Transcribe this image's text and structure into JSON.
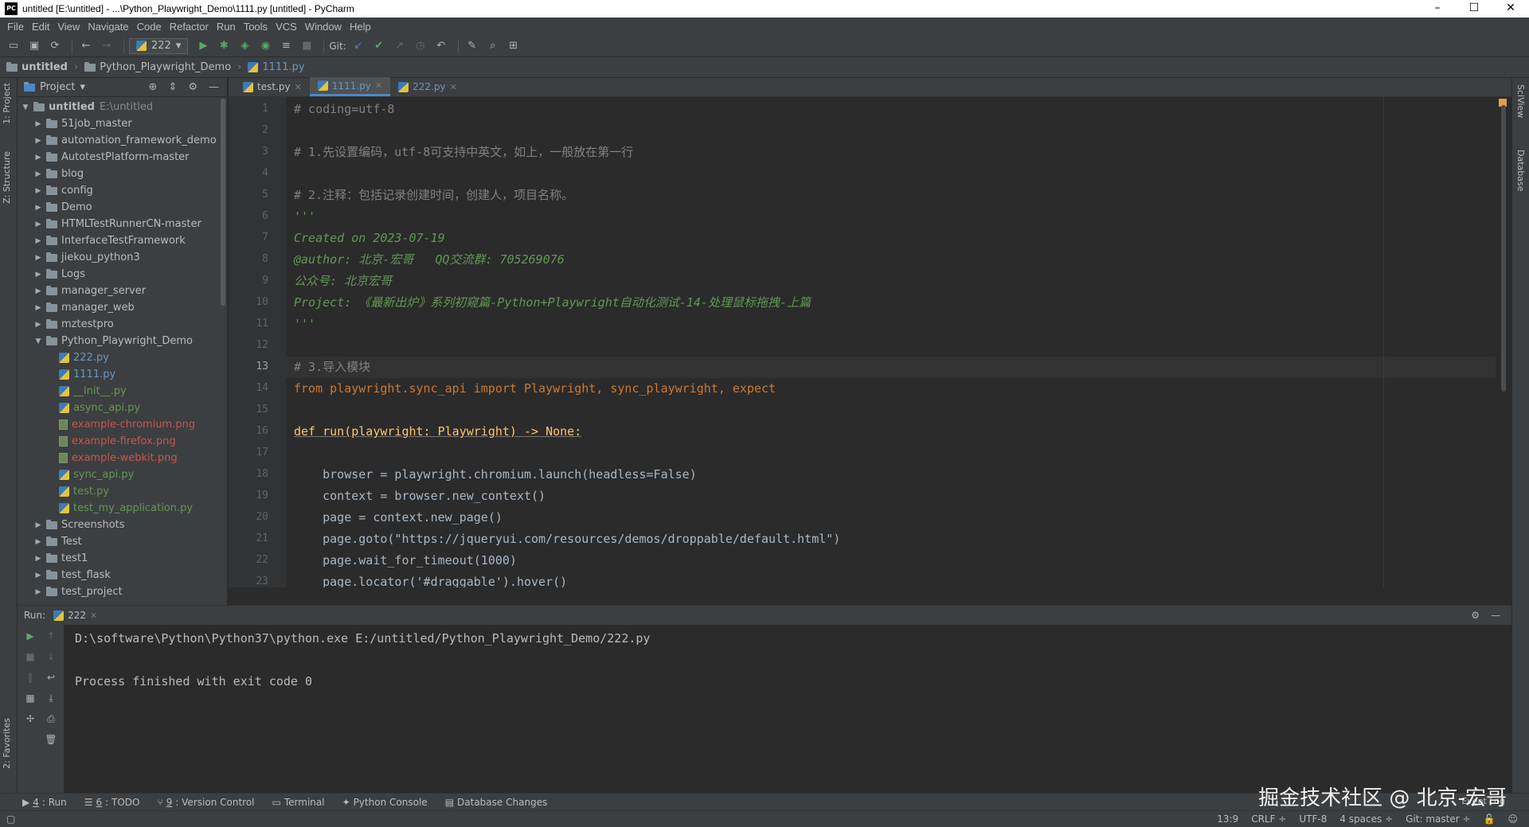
{
  "window": {
    "title": "untitled [E:\\untitled] - ...\\Python_Playwright_Demo\\1111.py [untitled] - PyCharm",
    "app_icon": "PC",
    "minimize": "–",
    "maximize": "☐",
    "close": "✕"
  },
  "menu": [
    "File",
    "Edit",
    "View",
    "Navigate",
    "Code",
    "Refactor",
    "Run",
    "Tools",
    "VCS",
    "Window",
    "Help"
  ],
  "toolbar": {
    "run_config": "222",
    "git_label": "Git:"
  },
  "breadcrumb": [
    "untitled",
    "Python_Playwright_Demo",
    "1111.py"
  ],
  "left_strip": {
    "project_tab": "1: Project",
    "structure_tab": "Z: Structure",
    "favorites_tab": "2: Favorites"
  },
  "right_strip": {
    "sciview_tab": "SciView",
    "database_tab": "Database"
  },
  "project_panel": {
    "title": "Project",
    "root_name": "untitled",
    "root_hint": "E:\\untitled",
    "folders_top": [
      "51job_master",
      "automation_framework_demo",
      "AutotestPlatform-master",
      "blog",
      "config",
      "Demo",
      "HTMLTestRunnerCN-master",
      "InterfaceTestFramework",
      "jiekou_python3",
      "Logs",
      "manager_server",
      "manager_web",
      "mztestpro"
    ],
    "open_folder": "Python_Playwright_Demo",
    "files": [
      {
        "name": "222.py",
        "kind": "py",
        "state": "modified"
      },
      {
        "name": "1111.py",
        "kind": "py",
        "state": "modified"
      },
      {
        "name": "__init__.py",
        "kind": "py",
        "state": "added"
      },
      {
        "name": "async_api.py",
        "kind": "py",
        "state": "added"
      },
      {
        "name": "example-chromium.png",
        "kind": "img",
        "state": "untracked"
      },
      {
        "name": "example-firefox.png",
        "kind": "img",
        "state": "untracked"
      },
      {
        "name": "example-webkit.png",
        "kind": "img",
        "state": "untracked"
      },
      {
        "name": "sync_api.py",
        "kind": "py",
        "state": "added"
      },
      {
        "name": "test.py",
        "kind": "py",
        "state": "added"
      },
      {
        "name": "test_my_application.py",
        "kind": "py",
        "state": "added"
      }
    ],
    "folders_bottom": [
      "Screenshots",
      "Test",
      "test1",
      "test_flask",
      "test_project"
    ]
  },
  "editor": {
    "tabs": [
      {
        "label": "test.py",
        "active": false
      },
      {
        "label": "1111.py",
        "active": true
      },
      {
        "label": "222.py",
        "active": false
      }
    ],
    "current_line": "13",
    "lines": [
      {
        "n": "1",
        "t": "# coding=utf-8"
      },
      {
        "n": "2",
        "t": ""
      },
      {
        "n": "3",
        "t": "# 1.先设置编码，utf-8可支持中英文，如上，一般放在第一行"
      },
      {
        "n": "4",
        "t": ""
      },
      {
        "n": "5",
        "t": "# 2.注释：包括记录创建时间，创建人，项目名称。"
      },
      {
        "n": "6",
        "t": "'''"
      },
      {
        "n": "7",
        "t": "Created on 2023-07-19"
      },
      {
        "n": "8",
        "t": "@author: 北京-宏哥   QQ交流群: 705269076"
      },
      {
        "n": "9",
        "t": "公众号: 北京宏哥"
      },
      {
        "n": "10",
        "t": "Project: 《最新出炉》系列初窥篇-Python+Playwright自动化测试-14-处理鼠标拖拽-上篇"
      },
      {
        "n": "11",
        "t": "'''"
      },
      {
        "n": "12",
        "t": ""
      },
      {
        "n": "13",
        "t": "# 3.导入模块"
      },
      {
        "n": "14",
        "t": "from playwright.sync_api import Playwright, sync_playwright, expect"
      },
      {
        "n": "15",
        "t": ""
      },
      {
        "n": "16",
        "t": "def run(playwright: Playwright) -> None:"
      },
      {
        "n": "17",
        "t": ""
      },
      {
        "n": "18",
        "t": "    browser = playwright.chromium.launch(headless=False)"
      },
      {
        "n": "19",
        "t": "    context = browser.new_context()"
      },
      {
        "n": "20",
        "t": "    page = context.new_page()"
      },
      {
        "n": "21",
        "t": "    page.goto(\"https://jqueryui.com/resources/demos/droppable/default.html\")"
      },
      {
        "n": "22",
        "t": "    page.wait_for_timeout(1000)"
      },
      {
        "n": "23",
        "t": "    page.locator('#draggable').hover()"
      }
    ]
  },
  "run_panel": {
    "label": "Run:",
    "tab": "222",
    "output": [
      "D:\\software\\Python\\Python37\\python.exe E:/untitled/Python_Playwright_Demo/222.py",
      "",
      "Process finished with exit code 0"
    ]
  },
  "bottom_tabs": [
    {
      "key": "4",
      "label": ": Run"
    },
    {
      "key": "6",
      "label": ": TODO"
    },
    {
      "key": "9",
      "label": ": Version Control"
    },
    {
      "key": "",
      "label": "Terminal"
    },
    {
      "key": "",
      "label": "Python Console"
    },
    {
      "key": "",
      "label": "Database Changes"
    }
  ],
  "status": {
    "position": "13:9",
    "line_sep": "CRLF ÷",
    "encoding": "UTF-8",
    "indent": "4 spaces ÷",
    "git": "Git: master ÷",
    "event_log": "Event Log"
  },
  "watermark": "掘金技术社区 @ 北京-宏哥"
}
